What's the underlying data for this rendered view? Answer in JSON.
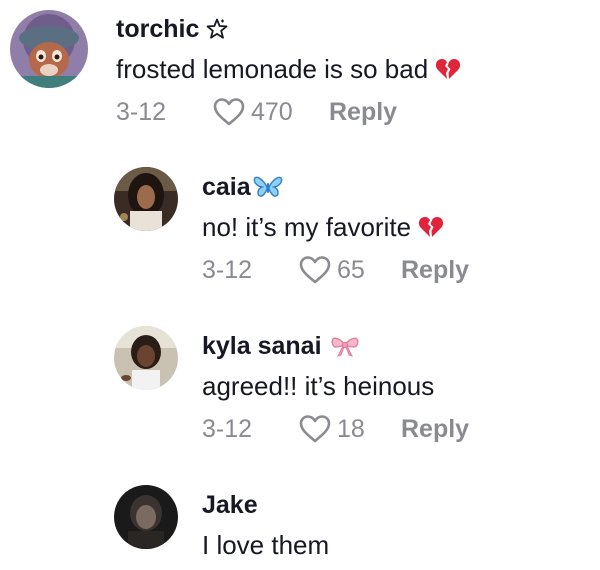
{
  "comments": [
    {
      "username": "torchic",
      "username_deco_icon": "star-outline-icon",
      "text": "frosted lemonade is so bad",
      "text_emoji_icon": "broken-heart-icon",
      "date": "3-12",
      "likes": "470",
      "reply_label": "Reply"
    },
    {
      "username": "caia",
      "username_deco_icon": "blue-butterfly-icon",
      "text": "no! it’s my favorite",
      "text_emoji_icon": "broken-heart-icon",
      "date": "3-12",
      "likes": "65",
      "reply_label": "Reply"
    },
    {
      "username": "kyla sanai",
      "username_deco_icon": "pink-ribbon-icon",
      "text": "agreed!! it’s heinous",
      "date": "3-12",
      "likes": "18",
      "reply_label": "Reply"
    },
    {
      "username": "Jake",
      "text": "I love them"
    }
  ],
  "colors": {
    "primary_text": "#161823",
    "secondary_text": "#8a8b91",
    "broken_heart": "#e0243a",
    "butterfly": "#3fa8e8",
    "ribbon": "#f29bb6"
  }
}
